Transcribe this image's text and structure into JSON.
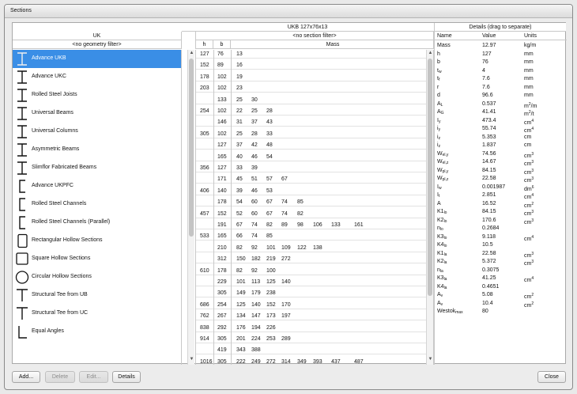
{
  "window": {
    "title": "Sections"
  },
  "tree": {
    "header": "UK",
    "filter": "<no geometry filter>"
  },
  "items": [
    {
      "label": "Advance UKB",
      "icon": "i-beam-icon",
      "selected": true
    },
    {
      "label": "Advance UKC",
      "icon": "i-beam-icon",
      "selected": false
    },
    {
      "label": "Rolled Steel Joists",
      "icon": "i-beam-icon",
      "selected": false
    },
    {
      "label": "Universal Beams",
      "icon": "i-beam-icon",
      "selected": false
    },
    {
      "label": "Universal Columns",
      "icon": "i-beam-icon",
      "selected": false
    },
    {
      "label": "Asymmetric Beams",
      "icon": "i-beam-icon",
      "selected": false
    },
    {
      "label": "Slimflor Fabricated Beams",
      "icon": "i-beam-icon",
      "selected": false
    },
    {
      "label": "Advance UKPFC",
      "icon": "channel-icon",
      "selected": false
    },
    {
      "label": "Rolled Steel Channels",
      "icon": "channel-icon",
      "selected": false
    },
    {
      "label": "Rolled Steel Channels (Parallel)",
      "icon": "channel-icon",
      "selected": false
    },
    {
      "label": "Rectangular Hollow Sections",
      "icon": "rectangle-hollow-icon",
      "selected": false
    },
    {
      "label": "Square Hollow Sections",
      "icon": "square-hollow-icon",
      "selected": false
    },
    {
      "label": "Circular Hollow Sections",
      "icon": "circle-hollow-icon",
      "selected": false
    },
    {
      "label": "Structural Tee from UB",
      "icon": "tee-icon",
      "selected": false
    },
    {
      "label": "Structural Tee from UC",
      "icon": "tee-icon",
      "selected": false
    },
    {
      "label": "Equal Angles",
      "icon": "angle-icon",
      "selected": false
    }
  ],
  "matrix": {
    "title": "UKB 127x76x13",
    "filter": "<no section filter>",
    "col_h": "h",
    "col_b": "b",
    "col_mass": "Mass",
    "rows": [
      {
        "h": "127",
        "b": "76",
        "m": [
          "13"
        ]
      },
      {
        "h": "152",
        "b": "89",
        "m": [
          "16"
        ]
      },
      {
        "h": "178",
        "b": "102",
        "m": [
          "19"
        ]
      },
      {
        "h": "203",
        "b": "102",
        "m": [
          "23"
        ]
      },
      {
        "h": "",
        "b": "133",
        "m": [
          "25",
          "30"
        ]
      },
      {
        "h": "254",
        "b": "102",
        "m": [
          "22",
          "25",
          "28"
        ]
      },
      {
        "h": "",
        "b": "146",
        "m": [
          "31",
          "37",
          "43"
        ]
      },
      {
        "h": "305",
        "b": "102",
        "m": [
          "25",
          "28",
          "33"
        ]
      },
      {
        "h": "",
        "b": "127",
        "m": [
          "37",
          "42",
          "48"
        ]
      },
      {
        "h": "",
        "b": "165",
        "m": [
          "40",
          "46",
          "54"
        ]
      },
      {
        "h": "356",
        "b": "127",
        "m": [
          "33",
          "39"
        ]
      },
      {
        "h": "",
        "b": "171",
        "m": [
          "45",
          "51",
          "57",
          "67"
        ]
      },
      {
        "h": "406",
        "b": "140",
        "m": [
          "39",
          "46",
          "53"
        ]
      },
      {
        "h": "",
        "b": "178",
        "m": [
          "54",
          "60",
          "67",
          "74",
          "85"
        ]
      },
      {
        "h": "457",
        "b": "152",
        "m": [
          "52",
          "60",
          "67",
          "74",
          "82"
        ]
      },
      {
        "h": "",
        "b": "191",
        "m": [
          "67",
          "74",
          "82",
          "89",
          "98",
          "106",
          "133",
          "161"
        ]
      },
      {
        "h": "533",
        "b": "165",
        "m": [
          "66",
          "74",
          "85"
        ]
      },
      {
        "h": "",
        "b": "210",
        "m": [
          "82",
          "92",
          "101",
          "109",
          "122",
          "138"
        ]
      },
      {
        "h": "",
        "b": "312",
        "m": [
          "150",
          "182",
          "219",
          "272"
        ]
      },
      {
        "h": "610",
        "b": "178",
        "m": [
          "82",
          "92",
          "100"
        ]
      },
      {
        "h": "",
        "b": "229",
        "m": [
          "101",
          "113",
          "125",
          "140"
        ]
      },
      {
        "h": "",
        "b": "305",
        "m": [
          "149",
          "179",
          "238"
        ]
      },
      {
        "h": "686",
        "b": "254",
        "m": [
          "125",
          "140",
          "152",
          "170"
        ]
      },
      {
        "h": "762",
        "b": "267",
        "m": [
          "134",
          "147",
          "173",
          "197"
        ]
      },
      {
        "h": "838",
        "b": "292",
        "m": [
          "176",
          "194",
          "226"
        ]
      },
      {
        "h": "914",
        "b": "305",
        "m": [
          "201",
          "224",
          "253",
          "289"
        ]
      },
      {
        "h": "",
        "b": "419",
        "m": [
          "343",
          "388"
        ]
      },
      {
        "h": "1016",
        "b": "305",
        "m": [
          "222",
          "249",
          "272",
          "314",
          "349",
          "393",
          "437",
          "487"
        ]
      }
    ]
  },
  "details": {
    "title": "Details (drag to separate)",
    "col_name": "Name",
    "col_value": "Value",
    "col_units": "Units",
    "rows": [
      {
        "n": "Mass",
        "s": "",
        "p": "",
        "v": "12.97",
        "u": "kg/m",
        "up": ""
      },
      {
        "n": "h",
        "s": "",
        "p": "",
        "v": "127",
        "u": "mm",
        "up": ""
      },
      {
        "n": "b",
        "s": "",
        "p": "",
        "v": "76",
        "u": "mm",
        "up": ""
      },
      {
        "n": "t",
        "s": "w",
        "p": "",
        "v": "4",
        "u": "mm",
        "up": ""
      },
      {
        "n": "t",
        "s": "f",
        "p": "",
        "v": "7.6",
        "u": "mm",
        "up": ""
      },
      {
        "n": "r",
        "s": "",
        "p": "",
        "v": "7.6",
        "u": "mm",
        "up": ""
      },
      {
        "n": "d",
        "s": "",
        "p": "",
        "v": "96.6",
        "u": "mm",
        "up": ""
      },
      {
        "n": "A",
        "s": "L",
        "p": "",
        "v": "0.537",
        "u": "m",
        "up": "2",
        "u2": "/m"
      },
      {
        "n": "A",
        "s": "G",
        "p": "",
        "v": "41.41",
        "u": "m",
        "up": "2",
        "u2": "/t"
      },
      {
        "n": "I",
        "s": "y",
        "p": "",
        "v": "473.4",
        "u": "cm",
        "up": "4"
      },
      {
        "n": "i",
        "s": "y",
        "p": "",
        "v": "55.74",
        "u": "cm",
        "up": "4"
      },
      {
        "n": "i",
        "s": "z",
        "p": "",
        "v": "5.353",
        "u": "cm",
        "up": ""
      },
      {
        "n": "i",
        "s": "z",
        "p": "",
        "v": "1.837",
        "u": "cm",
        "up": ""
      },
      {
        "n": "W",
        "s": "el,y",
        "p": "",
        "v": "74.56",
        "u": "cm",
        "up": "3"
      },
      {
        "n": "W",
        "s": "el,z",
        "p": "",
        "v": "14.67",
        "u": "cm",
        "up": "3"
      },
      {
        "n": "W",
        "s": "pl,y",
        "p": "",
        "v": "84.15",
        "u": "cm",
        "up": "3"
      },
      {
        "n": "W",
        "s": "pl,z",
        "p": "",
        "v": "22.58",
        "u": "cm",
        "up": "3"
      },
      {
        "n": "I",
        "s": "w",
        "p": "",
        "v": "0.001987",
        "u": "dm",
        "up": "6"
      },
      {
        "n": "I",
        "s": "t",
        "p": "",
        "v": "2.851",
        "u": "cm",
        "up": "4"
      },
      {
        "n": "A",
        "s": "",
        "p": "",
        "v": "16.52",
        "u": "cm",
        "up": "2"
      },
      {
        "n": "K1",
        "s": "lo",
        "p": "",
        "v": "84.15",
        "u": "cm",
        "up": "3"
      },
      {
        "n": "K2",
        "s": "lo",
        "p": "",
        "v": "170.6",
        "u": "cm",
        "up": "3"
      },
      {
        "n": "n",
        "s": "lo",
        "p": "",
        "v": "0.2684",
        "u": "",
        "up": ""
      },
      {
        "n": "K3",
        "s": "lo",
        "p": "",
        "v": "9.118",
        "u": "cm",
        "up": "4"
      },
      {
        "n": "K4",
        "s": "lo",
        "p": "",
        "v": "10.5",
        "u": "",
        "up": ""
      },
      {
        "n": "K1",
        "s": "la",
        "p": "",
        "v": "22.58",
        "u": "cm",
        "up": "3"
      },
      {
        "n": "K2",
        "s": "la",
        "p": "",
        "v": "5.372",
        "u": "cm",
        "up": "3"
      },
      {
        "n": "n",
        "s": "la",
        "p": "",
        "v": "0.3075",
        "u": "",
        "up": ""
      },
      {
        "n": "K3",
        "s": "la",
        "p": "",
        "v": "41.25",
        "u": "cm",
        "up": "4"
      },
      {
        "n": "K4",
        "s": "la",
        "p": "",
        "v": "0.4651",
        "u": "",
        "up": ""
      },
      {
        "n": "A",
        "s": "v",
        "p": "",
        "v": "5.08",
        "u": "cm",
        "up": "2"
      },
      {
        "n": "A",
        "s": "v",
        "p": "",
        "v": "10.4",
        "u": "cm",
        "up": "2"
      },
      {
        "n": "Westok",
        "s": "max",
        "p": "",
        "v": "80",
        "u": "",
        "up": ""
      }
    ]
  },
  "buttons": {
    "add": "Add...",
    "delete": "Delete",
    "edit": "Edit...",
    "details": "Details",
    "close": "Close"
  }
}
